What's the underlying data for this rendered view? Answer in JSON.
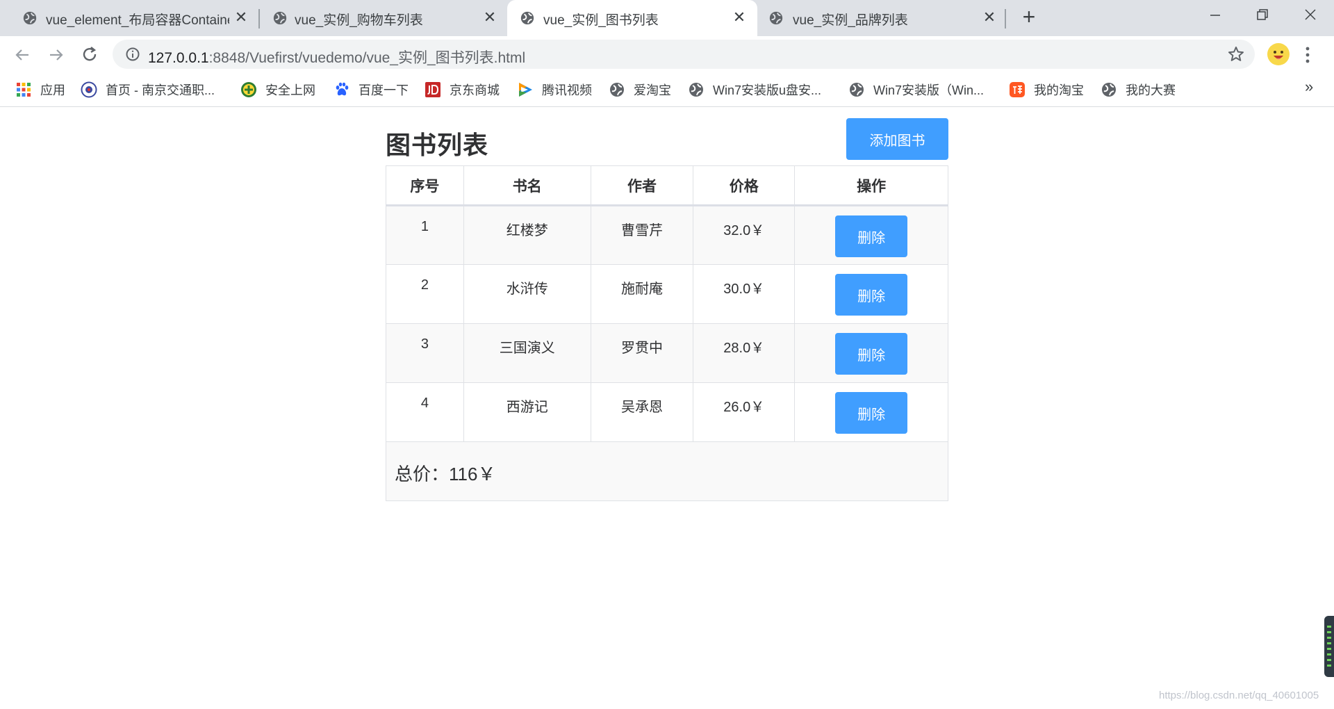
{
  "browser": {
    "tabs": [
      {
        "title": "vue_element_布局容器Container"
      },
      {
        "title": "vue_实例_购物车列表"
      },
      {
        "title": "vue_实例_图书列表"
      },
      {
        "title": "vue_实例_品牌列表"
      }
    ],
    "close_glyph": "✕",
    "new_tab_glyph": "+",
    "url_host": "127.0.0.1",
    "url_path": ":8848/Vuefirst/vuedemo/vue_实例_图书列表.html",
    "bookmarks": [
      {
        "label": "应用"
      },
      {
        "label": "首页 - 南京交通职..."
      },
      {
        "label": "安全上网"
      },
      {
        "label": "百度一下"
      },
      {
        "label": "京东商城"
      },
      {
        "label": "腾讯视频"
      },
      {
        "label": "爱淘宝"
      },
      {
        "label": "Win7安装版u盘安..."
      },
      {
        "label": "Win7安装版（Win..."
      },
      {
        "label": "我的淘宝"
      },
      {
        "label": "我的大赛"
      }
    ],
    "more_glyph": "»"
  },
  "page": {
    "title": "图书列表",
    "add_button_label": "添加图书",
    "table": {
      "headers": [
        "序号",
        "书名",
        "作者",
        "价格",
        "操作"
      ],
      "rows": [
        {
          "index": "1",
          "name": "红楼梦",
          "author": "曹雪芹",
          "price": "32.0￥",
          "action": "删除"
        },
        {
          "index": "2",
          "name": "水浒传",
          "author": "施耐庵",
          "price": "30.0￥",
          "action": "删除"
        },
        {
          "index": "3",
          "name": "三国演义",
          "author": "罗贯中",
          "price": "28.0￥",
          "action": "删除"
        },
        {
          "index": "4",
          "name": "西游记",
          "author": "吴承恩",
          "price": "26.0￥",
          "action": "删除"
        }
      ],
      "total_text": "总价：116￥"
    }
  },
  "watermark": "https://blog.csdn.net/qq_40601005",
  "colors": {
    "primary": "#409eff",
    "tab_strip": "#dee1e6",
    "omnibox": "#f1f3f4",
    "row_alt": "#f9f9f9"
  }
}
